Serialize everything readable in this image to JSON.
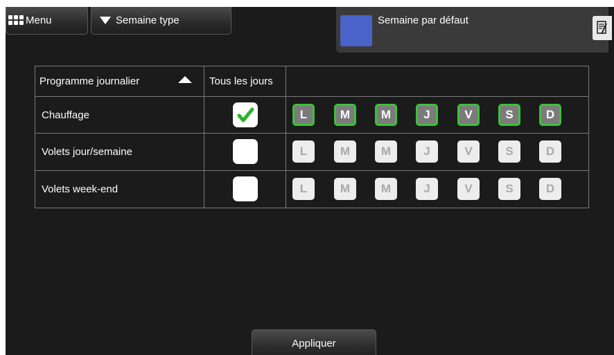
{
  "topbar": {
    "menu_label": "Menu",
    "week_selector_label": "Semaine type",
    "profile": {
      "name": "Semaine par défaut",
      "color": "#4a63c8"
    }
  },
  "table": {
    "headers": {
      "program": "Programme journalier",
      "all_days": "Tous les jours"
    },
    "rows": [
      {
        "label": "Chauffage",
        "all_days": true,
        "days": [
          {
            "letter": "L",
            "active": true
          },
          {
            "letter": "M",
            "active": true
          },
          {
            "letter": "M",
            "active": true
          },
          {
            "letter": "J",
            "active": true
          },
          {
            "letter": "V",
            "active": true
          },
          {
            "letter": "S",
            "active": true
          },
          {
            "letter": "D",
            "active": true
          }
        ]
      },
      {
        "label": "Volets jour/semaine",
        "all_days": false,
        "days": [
          {
            "letter": "L",
            "active": false
          },
          {
            "letter": "M",
            "active": false
          },
          {
            "letter": "M",
            "active": false
          },
          {
            "letter": "J",
            "active": false
          },
          {
            "letter": "V",
            "active": false
          },
          {
            "letter": "S",
            "active": false
          },
          {
            "letter": "D",
            "active": false
          }
        ]
      },
      {
        "label": "Volets week-end",
        "all_days": false,
        "days": [
          {
            "letter": "L",
            "active": false
          },
          {
            "letter": "M",
            "active": false
          },
          {
            "letter": "M",
            "active": false
          },
          {
            "letter": "J",
            "active": false
          },
          {
            "letter": "V",
            "active": false
          },
          {
            "letter": "S",
            "active": false
          },
          {
            "letter": "D",
            "active": false
          }
        ]
      }
    ]
  },
  "apply_label": "Appliquer",
  "colors": {
    "active_border": "#3cc13a",
    "active_fill": "#7b7b7b",
    "inactive_fill": "#ededed",
    "check": "#2db12a"
  }
}
